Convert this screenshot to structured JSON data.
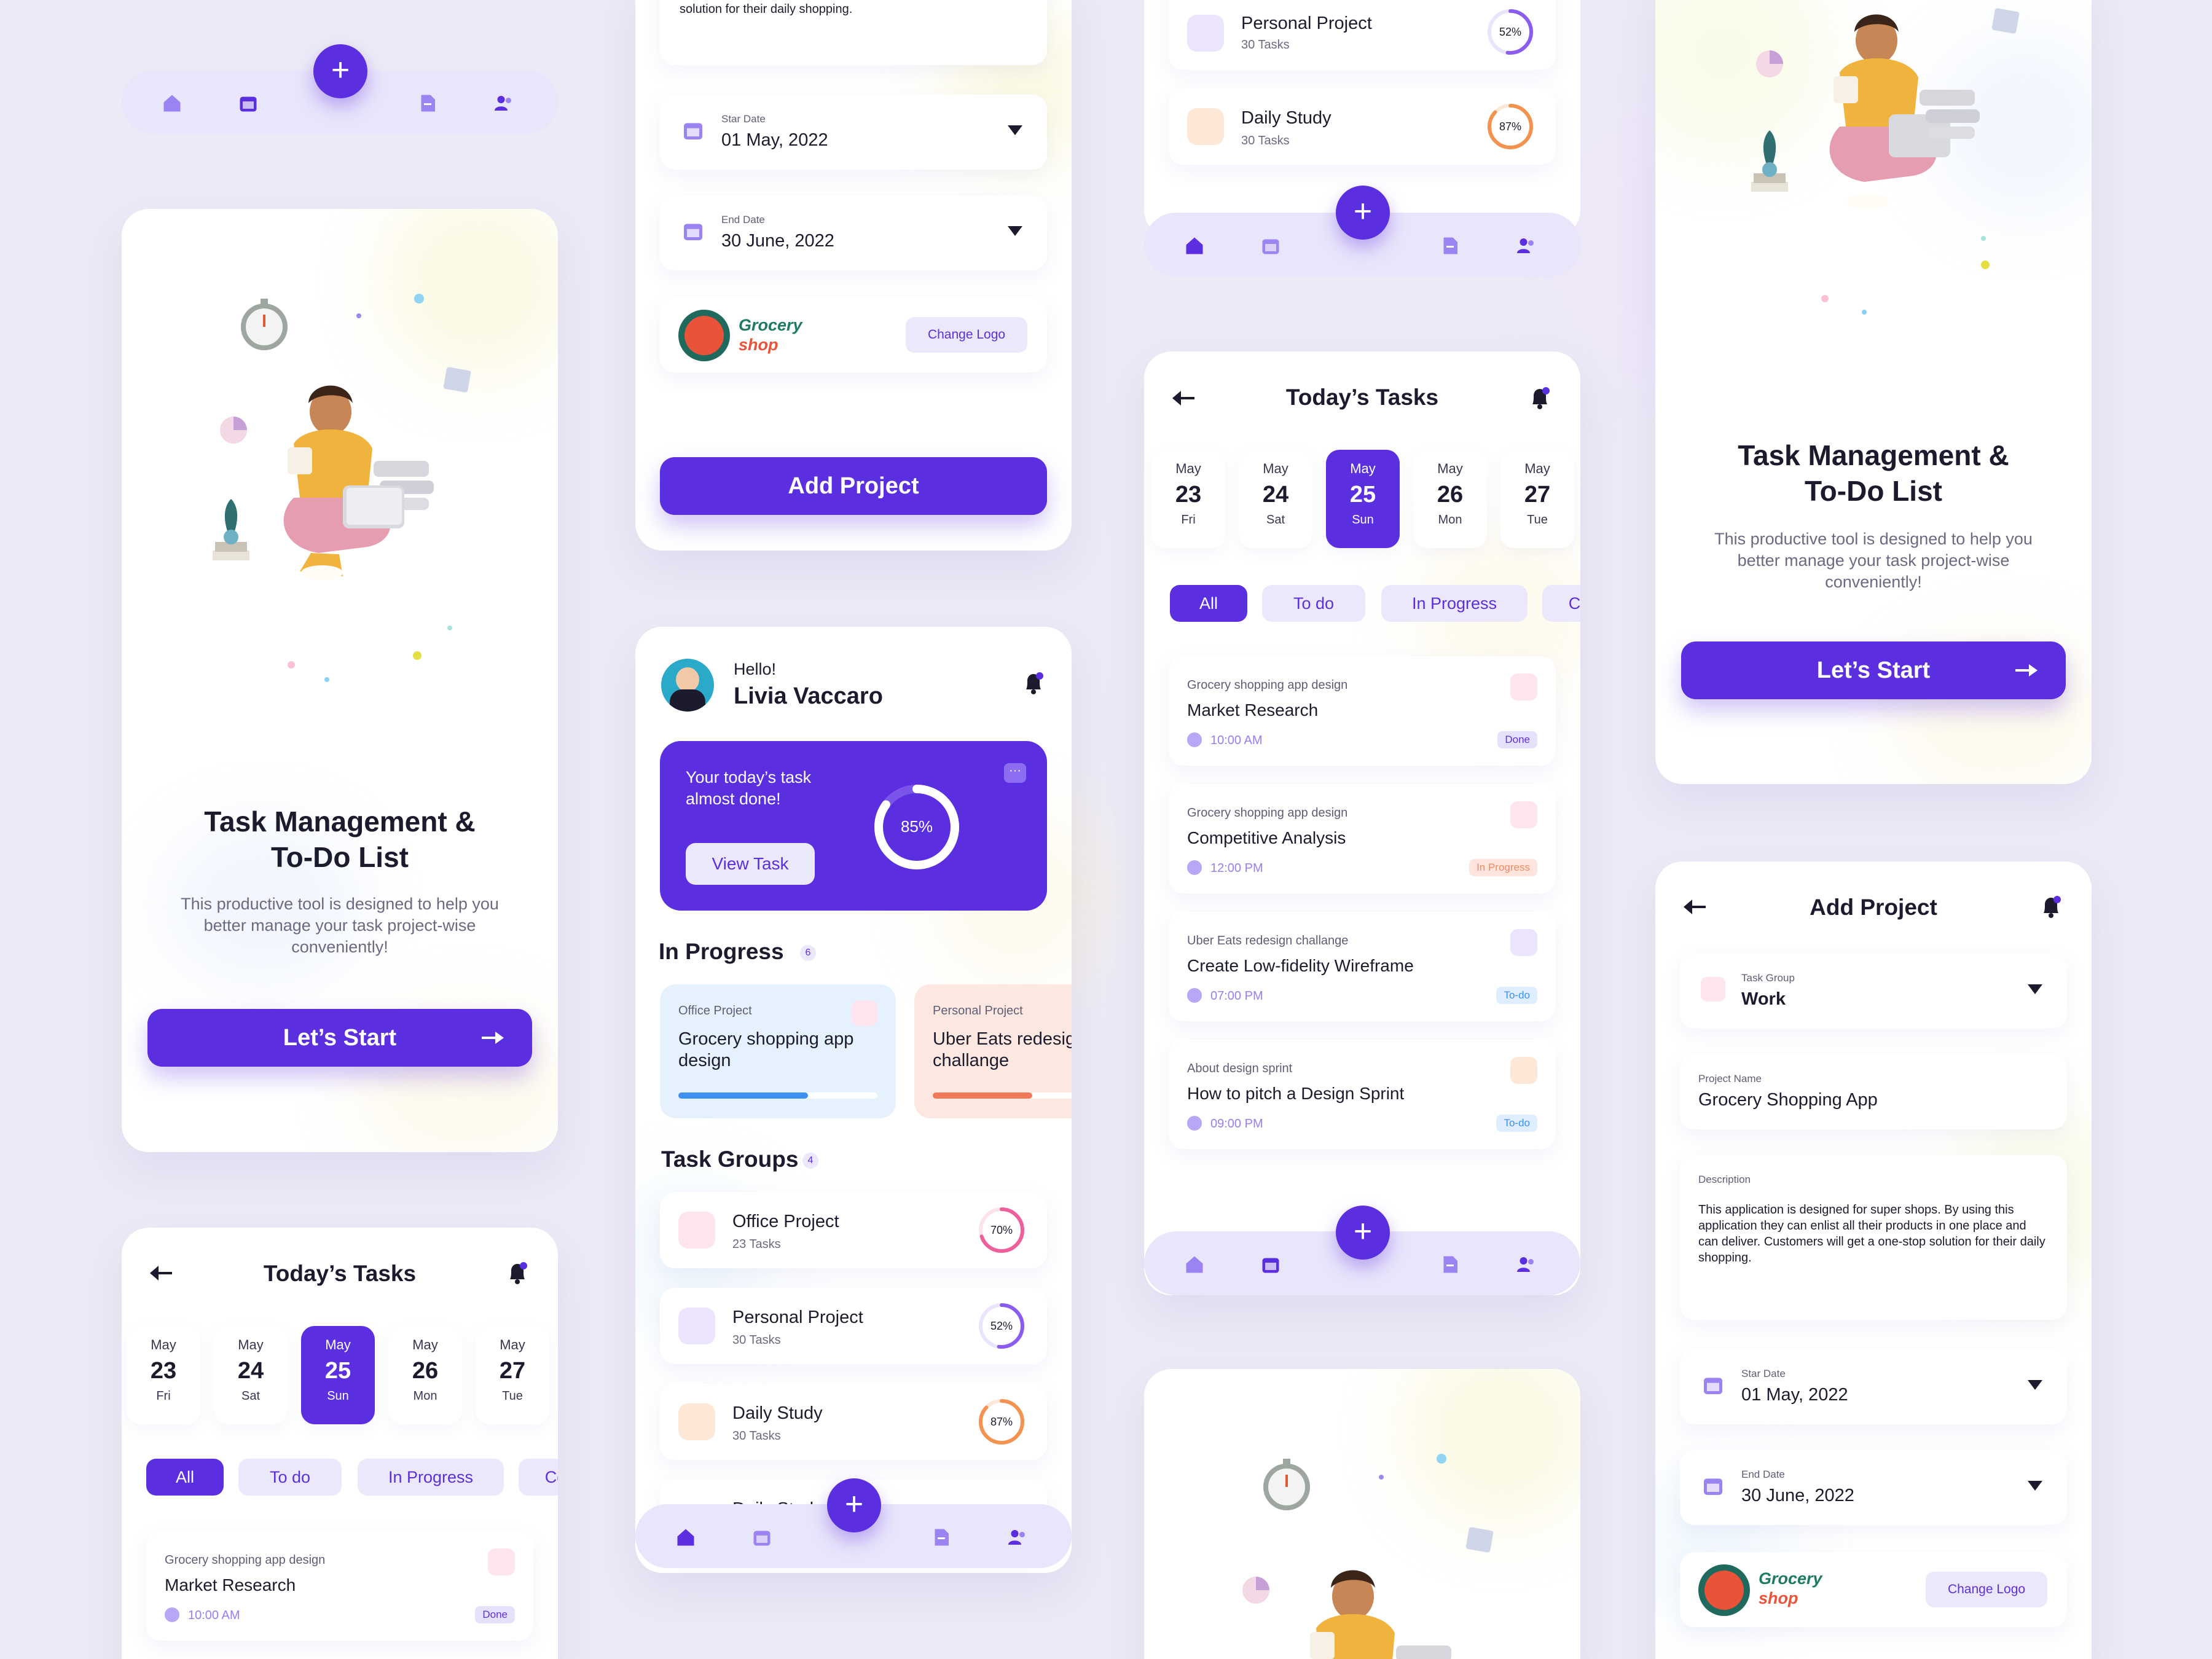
{
  "colors": {
    "primary": "#5b2ee0",
    "bg": "#eceaf6",
    "pink": "#ee5f9b",
    "orange": "#f4934f",
    "blue": "#3f8ff0"
  },
  "onboarding": {
    "title_line1": "Task Management &",
    "title_line2": "To-Do List",
    "description": "This productive tool is designed to help you better manage your task project-wise conveniently!",
    "cta": "Let’s Start"
  },
  "today": {
    "title": "Today’s Tasks",
    "days": [
      {
        "month": "May",
        "date": "23",
        "weekday": "Fri",
        "active": false
      },
      {
        "month": "May",
        "date": "24",
        "weekday": "Sat",
        "active": false
      },
      {
        "month": "May",
        "date": "25",
        "weekday": "Sun",
        "active": true
      },
      {
        "month": "May",
        "date": "26",
        "weekday": "Mon",
        "active": false
      },
      {
        "month": "May",
        "date": "27",
        "weekday": "Tue",
        "active": false
      }
    ],
    "filters": [
      "All",
      "To do",
      "In Progress",
      "Co"
    ],
    "tasks": [
      {
        "group": "Grocery shopping app design",
        "name": "Market Research",
        "time": "10:00 AM",
        "status": "Done"
      },
      {
        "group": "Grocery shopping app design",
        "name": "Competitive Analysis",
        "time": "12:00 PM",
        "status": "In Progress"
      },
      {
        "group": "Uber Eats redesign challange",
        "name": "Create Low-fidelity Wireframe",
        "time": "07:00 PM",
        "status": "To-do"
      },
      {
        "group": "About design sprint",
        "name": "How to pitch a Design Sprint",
        "time": "09:00 PM",
        "status": "To-do"
      }
    ]
  },
  "add_project": {
    "title": "Add Project",
    "task_group_label": "Task Group",
    "task_group_value": "Work",
    "project_name_label": "Project Name",
    "project_name_value": "Grocery Shopping App",
    "description_label": "Description",
    "description_value": "This application is designed for super shops. By using this application they can enlist all their products in one place and can deliver. Customers will get a one-stop solution for their daily shopping.",
    "description_tail": "solution for their daily shopping.",
    "start_label": "Star Date",
    "start_value": "01 May, 2022",
    "end_label": "End Date",
    "end_value": "30 June, 2022",
    "logo_line1": "Grocery",
    "logo_line2": "shop",
    "change_logo": "Change Logo",
    "submit": "Add Project"
  },
  "home": {
    "greeting": "Hello!",
    "user_name": "Livia Vaccaro",
    "banner_text": "Your today’s task almost done!",
    "banner_button": "View Task",
    "banner_progress": "85%",
    "banner_progress_value": 85,
    "in_progress_title": "In Progress",
    "in_progress_count": "6",
    "in_progress": [
      {
        "category": "Office Project",
        "name": "Grocery shopping app design",
        "progress": 0.65
      },
      {
        "category": "Personal Project",
        "name": "Uber Eats redesign challange",
        "progress": 0.5
      }
    ],
    "task_groups_title": "Task Groups",
    "task_groups_count": "4",
    "groups": [
      {
        "name": "Office Project",
        "count": "23 Tasks",
        "percent": "70%",
        "value": 70,
        "color": "#ee5f9b"
      },
      {
        "name": "Personal Project",
        "count": "30 Tasks",
        "percent": "52%",
        "value": 52,
        "color": "#8a5cf0"
      },
      {
        "name": "Daily Study",
        "count": "30 Tasks",
        "percent": "87%",
        "value": 87,
        "color": "#f4934f"
      }
    ],
    "partial_group": "Daily Study"
  }
}
